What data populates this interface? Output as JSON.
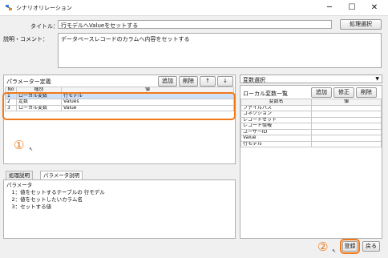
{
  "window": {
    "title": "シナリオリレーション",
    "minimize": "─",
    "maximize": "☐",
    "close": "✕"
  },
  "form": {
    "title_label": "タイトル：",
    "title_value": "行モデルへValueをセットする",
    "process_select_button": "処理選択",
    "description_label": "説明・コメント：",
    "description_value": "データベースレコードのカラムへ内容をセットする"
  },
  "param_panel": {
    "header_label": "パラメーター定義",
    "add_button": "追加",
    "delete_button": "削除",
    "up_button": "↑",
    "down_button": "↓",
    "columns": [
      "No",
      "種別",
      "値"
    ],
    "rows": [
      {
        "no": "1",
        "type": "ローカル変数",
        "value": "行モデル"
      },
      {
        "no": "2",
        "type": "定数",
        "value": "Values"
      },
      {
        "no": "3",
        "type": "ローカル変数",
        "value": "Value"
      }
    ]
  },
  "annotations": {
    "marker1": "①",
    "marker2": "②"
  },
  "tabs": {
    "items": [
      "処理説明",
      "パラメータ説明"
    ],
    "active_index": 1
  },
  "param_desc": {
    "lines": [
      "パラメータ",
      "　1：値をセットするテーブルの 行モデル",
      "　2：値をセットしたいカラム名",
      "　3：セットする値"
    ]
  },
  "var_panel": {
    "select_value": "変数選択",
    "list_label": "ローカル変数一覧",
    "add_button": "追加",
    "edit_button": "修正",
    "delete_button": "削除",
    "columns": [
      "変数名",
      "値"
    ],
    "rows": [
      "ファイルパス",
      "コネクション",
      "レコードセット",
      "レコード情報",
      "ユーザーID",
      "Value",
      "行モデル"
    ]
  },
  "footer": {
    "register_button": "登録",
    "back_button": "戻る"
  },
  "colors": {
    "highlight": "#f07a1a",
    "selection": "#cfe0f7"
  }
}
